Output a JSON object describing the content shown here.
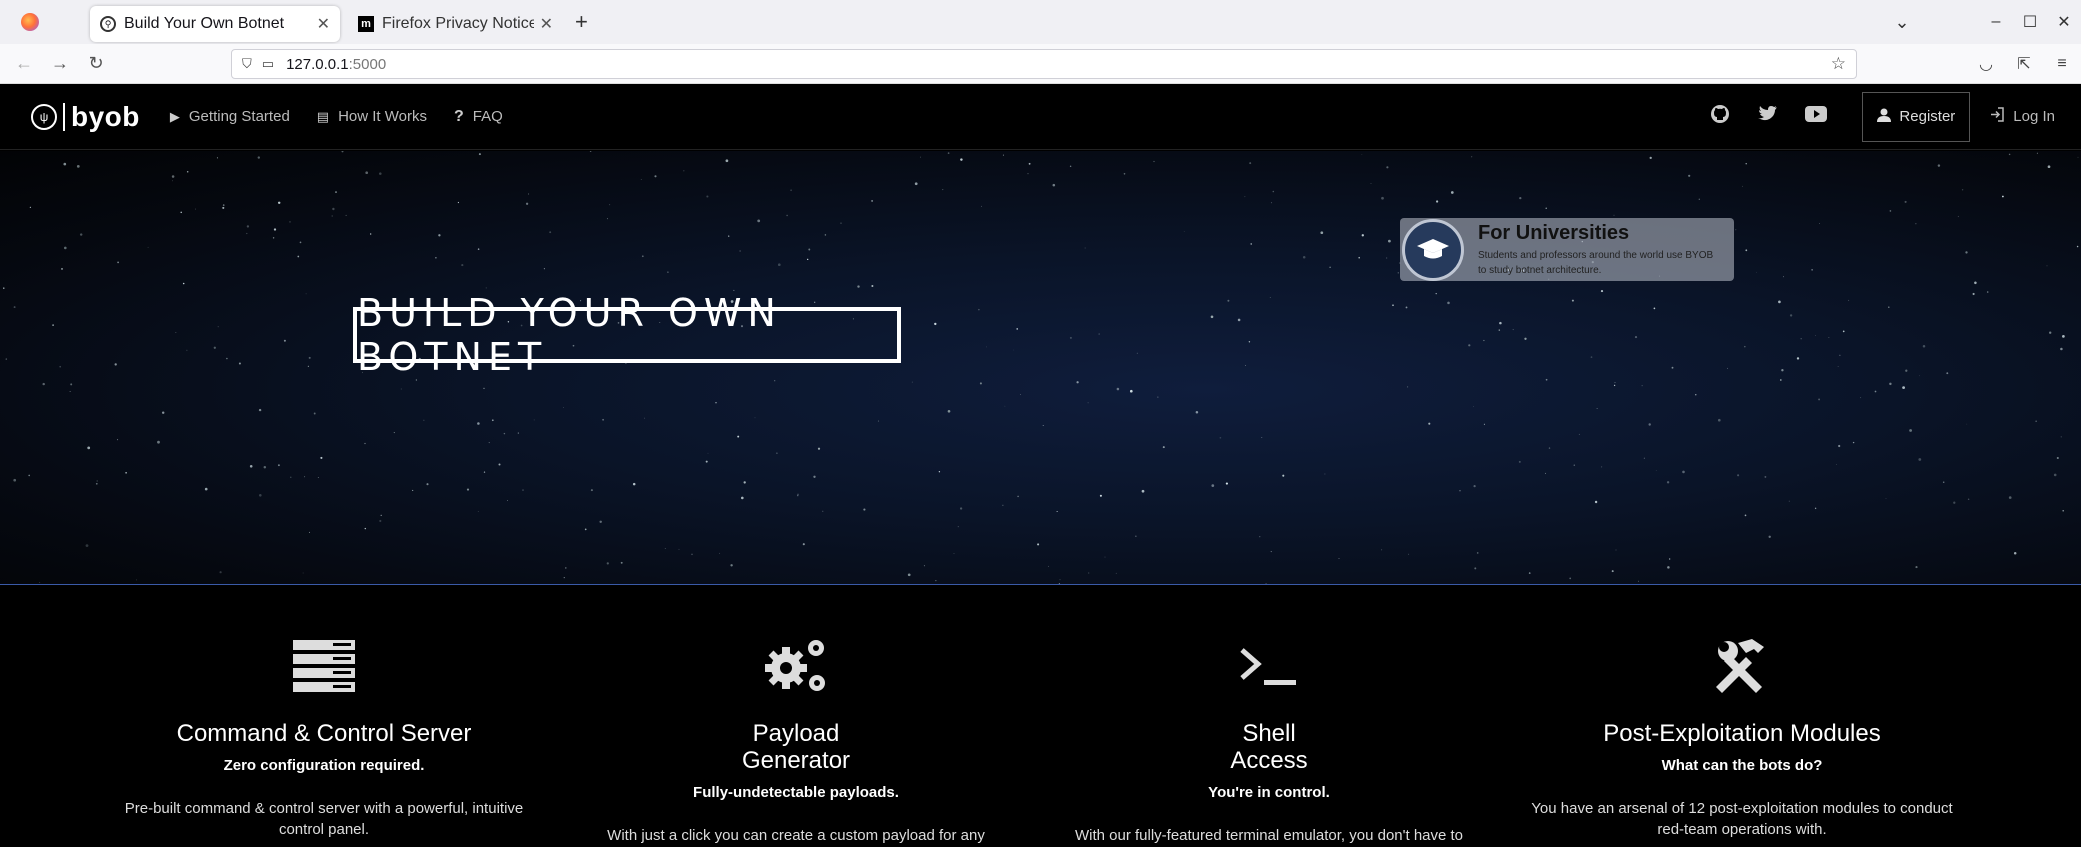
{
  "browser": {
    "tabs": [
      {
        "title": "Build Your Own Botnet",
        "active": true
      },
      {
        "title": "Firefox Privacy Notice —",
        "active": false
      }
    ],
    "url": {
      "host": "127.0.0.1",
      "port": ":5000"
    }
  },
  "header": {
    "brand": "byob",
    "menu": [
      {
        "label": "Getting Started",
        "icon": "play-icon"
      },
      {
        "label": "How It Works",
        "icon": "document-icon"
      },
      {
        "label": "FAQ",
        "icon": "question-icon"
      }
    ],
    "social": [
      "github-icon",
      "twitter-icon",
      "youtube-icon"
    ],
    "register_label": "Register",
    "login_label": "Log In"
  },
  "hero": {
    "title": "BUILD YOUR OWN BOTNET",
    "banner": {
      "heading": "For Universities",
      "description_line1": "Students and professors around the world use BYOB",
      "description_line2": "to study botnet architecture."
    }
  },
  "features": [
    {
      "icon": "server-icon",
      "title_line1": "Command & Control Server",
      "title_line2": "",
      "subtitle": "Zero configuration required.",
      "description": "Pre-built command & control server with a powerful, intuitive control panel."
    },
    {
      "icon": "gears-icon",
      "title_line1": "Payload",
      "title_line2": "Generator",
      "subtitle": "Fully-undetectable payloads.",
      "description": "With just a click you can create a custom payload for any"
    },
    {
      "icon": "terminal-icon",
      "title_line1": "Shell",
      "title_line2": "Access",
      "subtitle": "You're in control.",
      "description": "With our fully-featured terminal emulator, you don't have to"
    },
    {
      "icon": "tools-icon",
      "title_line1": "Post-Exploitation Modules",
      "title_line2": "",
      "subtitle": "What can the bots do?",
      "description": "You have an arsenal of 12 post-exploitation modules to conduct red-team operations with."
    }
  ]
}
